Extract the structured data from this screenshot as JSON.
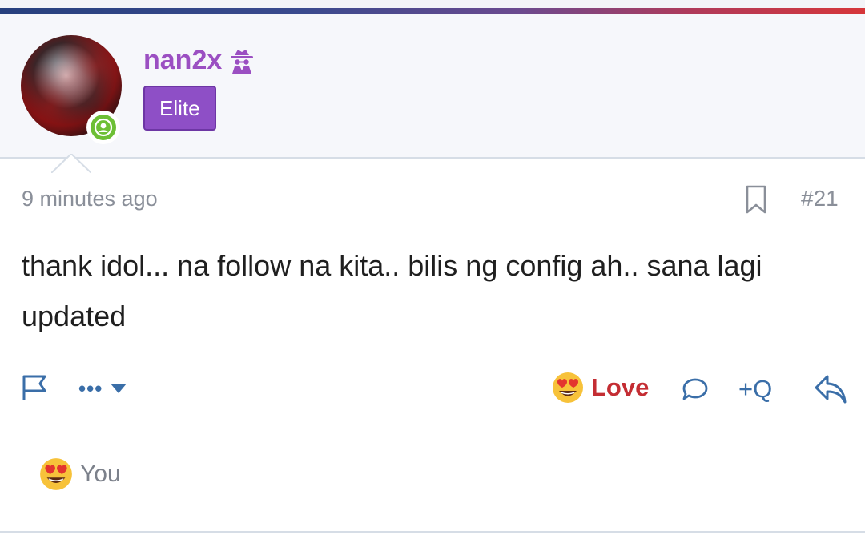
{
  "post": {
    "author": {
      "username": "nan2x",
      "user_title": "Elite",
      "status": "online",
      "badge_icon": "spy-icon"
    },
    "meta": {
      "time": "9 minutes ago",
      "post_number": "#21"
    },
    "body": "thank idol... na follow na kita.. bilis ng config ah.. sana lagi updated",
    "actions": {
      "more_label": "•••",
      "reaction_label": "Love",
      "quote_label": "+Q"
    },
    "reactions": {
      "summary_label": "You"
    }
  },
  "colors": {
    "username": "#9b4fc2",
    "title_bg": "#8e4fc6",
    "love": "#c42d33",
    "action_blue": "#3a6ea8",
    "online": "#6dbf35"
  }
}
